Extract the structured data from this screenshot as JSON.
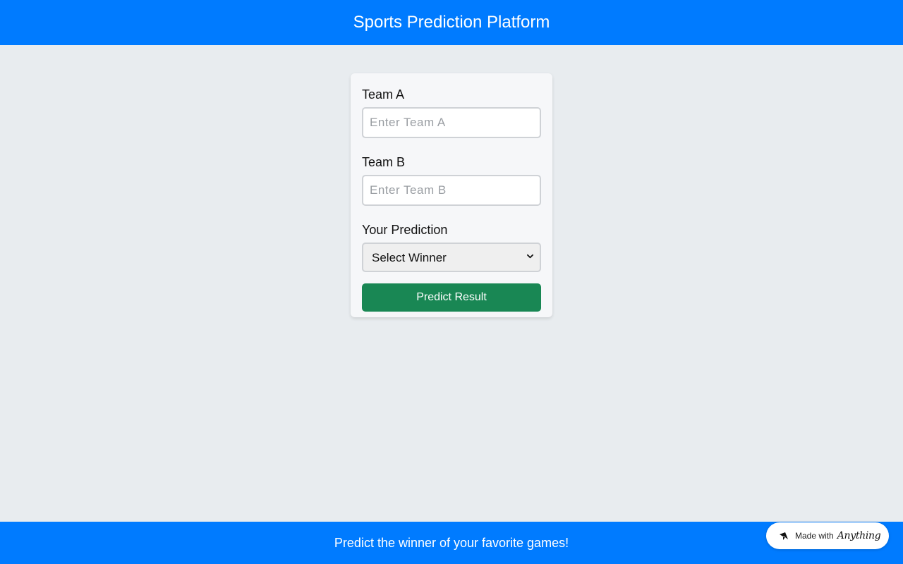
{
  "header": {
    "title": "Sports Prediction Platform"
  },
  "form": {
    "team_a": {
      "label": "Team A",
      "value": "",
      "placeholder": "Enter Team A"
    },
    "team_b": {
      "label": "Team B",
      "value": "",
      "placeholder": "Enter Team B"
    },
    "prediction": {
      "label": "Your Prediction",
      "selected": "Select Winner"
    },
    "submit_label": "Predict Result"
  },
  "footer": {
    "text": "Predict the winner of your favorite games!"
  },
  "badge": {
    "made_with": "Made with",
    "brand": "Anything",
    "icon": "anything-logo-icon"
  },
  "colors": {
    "primary": "#007bff",
    "success": "#198754",
    "background": "#e8ecef",
    "card": "#f6f7f9"
  }
}
